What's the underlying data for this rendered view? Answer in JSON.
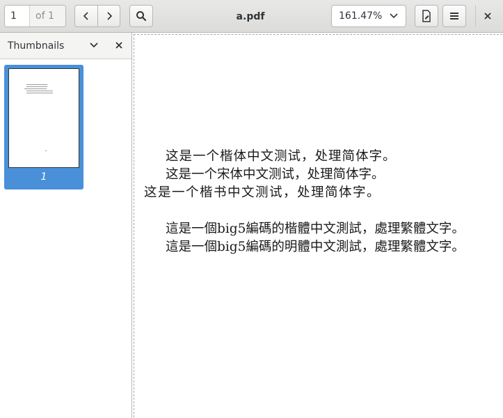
{
  "header": {
    "page_current": "1",
    "page_of": "of 1",
    "title": "a.pdf",
    "zoom": "161.47%",
    "icons": {
      "prev": "chevron-left-icon",
      "next": "chevron-right-icon",
      "search": "search-icon",
      "zoom_dropdown": "chevron-down-icon",
      "annotations": "document-edit-icon",
      "menu": "hamburger-menu-icon",
      "close": "close-icon"
    }
  },
  "sidebar": {
    "title": "Thumbnails",
    "thumbnails": [
      {
        "label": "1"
      }
    ]
  },
  "document": {
    "lines": [
      "这是一个楷体中文测试，处理简体字。",
      "这是一个宋体中文测试，处理简体字。",
      "这是一个楷书中文测试，处理简体字。",
      "這是一個big5編碼的楷體中文測試，處理繁體文字。",
      "這是一個big5編碼的明體中文測試，處理繁體文字。"
    ]
  },
  "colors": {
    "selection": "#4a90d9",
    "headerbar": "#e8e8e7"
  }
}
